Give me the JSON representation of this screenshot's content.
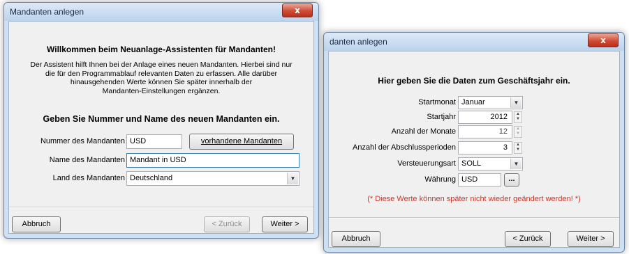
{
  "dialog1": {
    "title": "Mandanten anlegen",
    "close_glyph": "x",
    "welcome_heading": "Willkommen beim Neuanlage-Assistenten für Mandanten!",
    "intro_lines": [
      "Der Assistent hilft Ihnen bei der Anlage eines neuen Mandanten. Hierbei sind nur",
      "die für den Programmablauf relevanten Daten zu erfassen. Alle darüber",
      "hinausgehenden Werte können Sie später innerhalb der",
      "Mandanten-Einstellungen ergänzen."
    ],
    "section_heading": "Geben Sie Nummer und Name des neuen Mandanten ein.",
    "number_label": "Nummer des Mandanten",
    "number_value": "USD",
    "existing_button": "vorhandene Mandanten",
    "name_label": "Name des Mandanten",
    "name_value": "Mandant in USD",
    "country_label": "Land des Mandanten",
    "country_value": "Deutschland",
    "cancel_button": "Abbruch",
    "back_button": "< Zurück",
    "next_button": "Weiter >"
  },
  "dialog2": {
    "title": "danten anlegen",
    "close_glyph": "x",
    "heading": "Hier geben Sie die Daten zum Geschäftsjahr ein.",
    "start_month_label": "Startmonat",
    "start_month_value": "Januar",
    "start_year_label": "Startjahr",
    "start_year_value": "2012",
    "months_label": "Anzahl der Monate",
    "months_value": "12",
    "periods_label": "Anzahl der Abschlussperioden",
    "periods_value": "3",
    "tax_label": "Versteuerungsart",
    "tax_value": "SOLL",
    "currency_label": "Währung",
    "currency_value": "USD",
    "currency_button": "...",
    "warning": "(* Diese Werte können später nicht wieder geändert werden! *)",
    "cancel_button": "Abbruch",
    "back_button": "< Zurück",
    "next_button": "Weiter >"
  },
  "colors": {
    "warning": "#c0392b",
    "frame": "#cfe0f3",
    "close": "#cf4b34"
  },
  "icons": [
    "close-icon",
    "dropdown-arrow-icon",
    "spin-up-icon",
    "spin-down-icon"
  ]
}
